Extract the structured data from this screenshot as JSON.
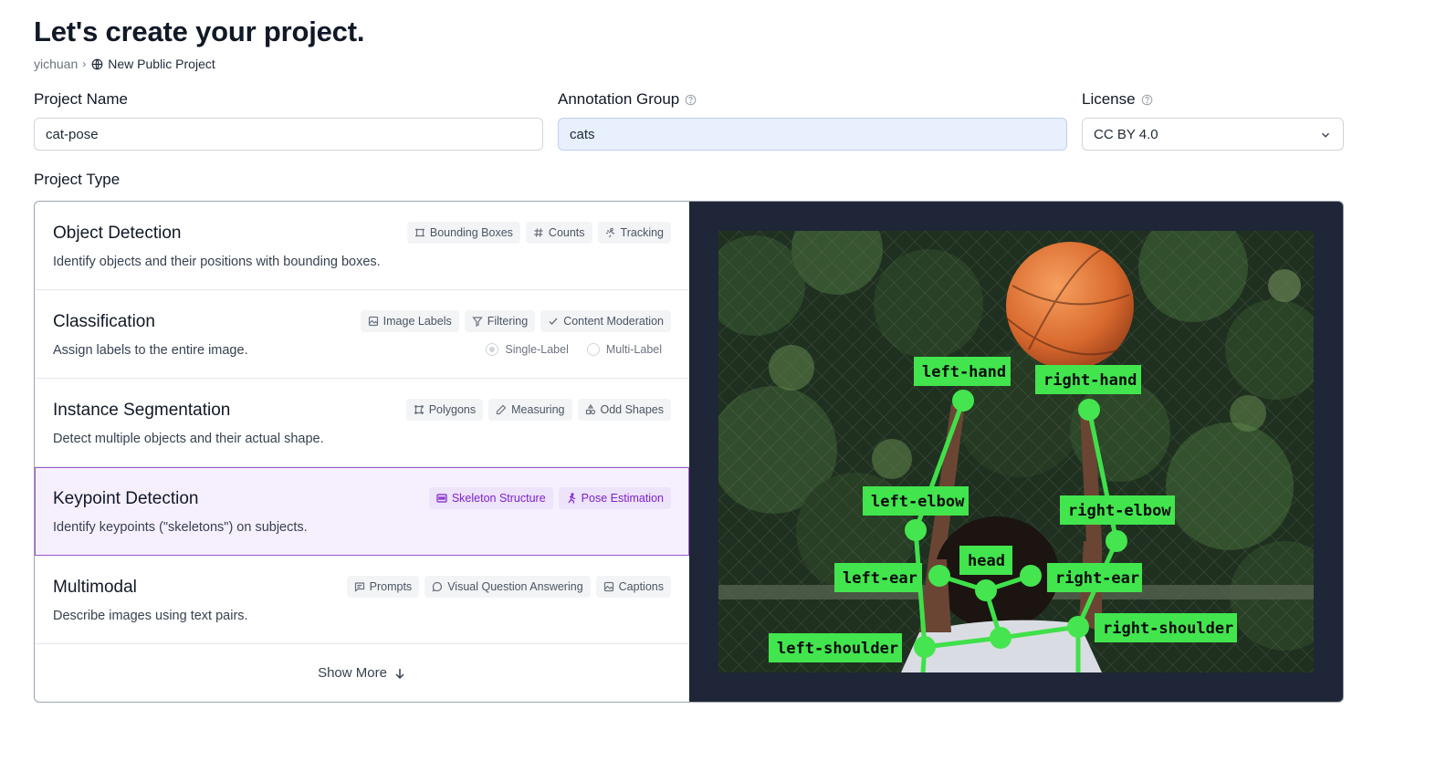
{
  "page": {
    "title": "Let's create your project.",
    "breadcrumb": {
      "user": "yichuan",
      "current": "New Public Project"
    }
  },
  "form": {
    "project_name": {
      "label": "Project Name",
      "value": "cat-pose"
    },
    "annotation_group": {
      "label": "Annotation Group",
      "value": "cats"
    },
    "license": {
      "label": "License",
      "value": "CC BY 4.0"
    }
  },
  "project_type": {
    "label": "Project Type",
    "types": [
      {
        "name": "Object Detection",
        "desc": "Identify objects and their positions with bounding boxes.",
        "tags": [
          "Bounding Boxes",
          "Counts",
          "Tracking"
        ]
      },
      {
        "name": "Classification",
        "desc": "Assign labels to the entire image.",
        "tags": [
          "Image Labels",
          "Filtering",
          "Content Moderation"
        ],
        "options": [
          "Single-Label",
          "Multi-Label"
        ]
      },
      {
        "name": "Instance Segmentation",
        "desc": "Detect multiple objects and their actual shape.",
        "tags": [
          "Polygons",
          "Measuring",
          "Odd Shapes"
        ]
      },
      {
        "name": "Keypoint Detection",
        "desc": "Identify keypoints (\"skeletons\") on subjects.",
        "tags": [
          "Skeleton Structure",
          "Pose Estimation"
        ],
        "selected": true
      },
      {
        "name": "Multimodal",
        "desc": "Describe images using text pairs.",
        "tags": [
          "Prompts",
          "Visual Question Answering",
          "Captions"
        ]
      }
    ],
    "show_more": "Show More"
  },
  "preview": {
    "keypoints": [
      "left-hand",
      "right-hand",
      "left-elbow",
      "right-elbow",
      "head",
      "left-ear",
      "right-ear",
      "right-shoulder",
      "left-shoulder"
    ]
  },
  "colors": {
    "accent": "#9b59c9",
    "keypoint": "#3fe04a",
    "preview_bg": "#1e2637"
  }
}
